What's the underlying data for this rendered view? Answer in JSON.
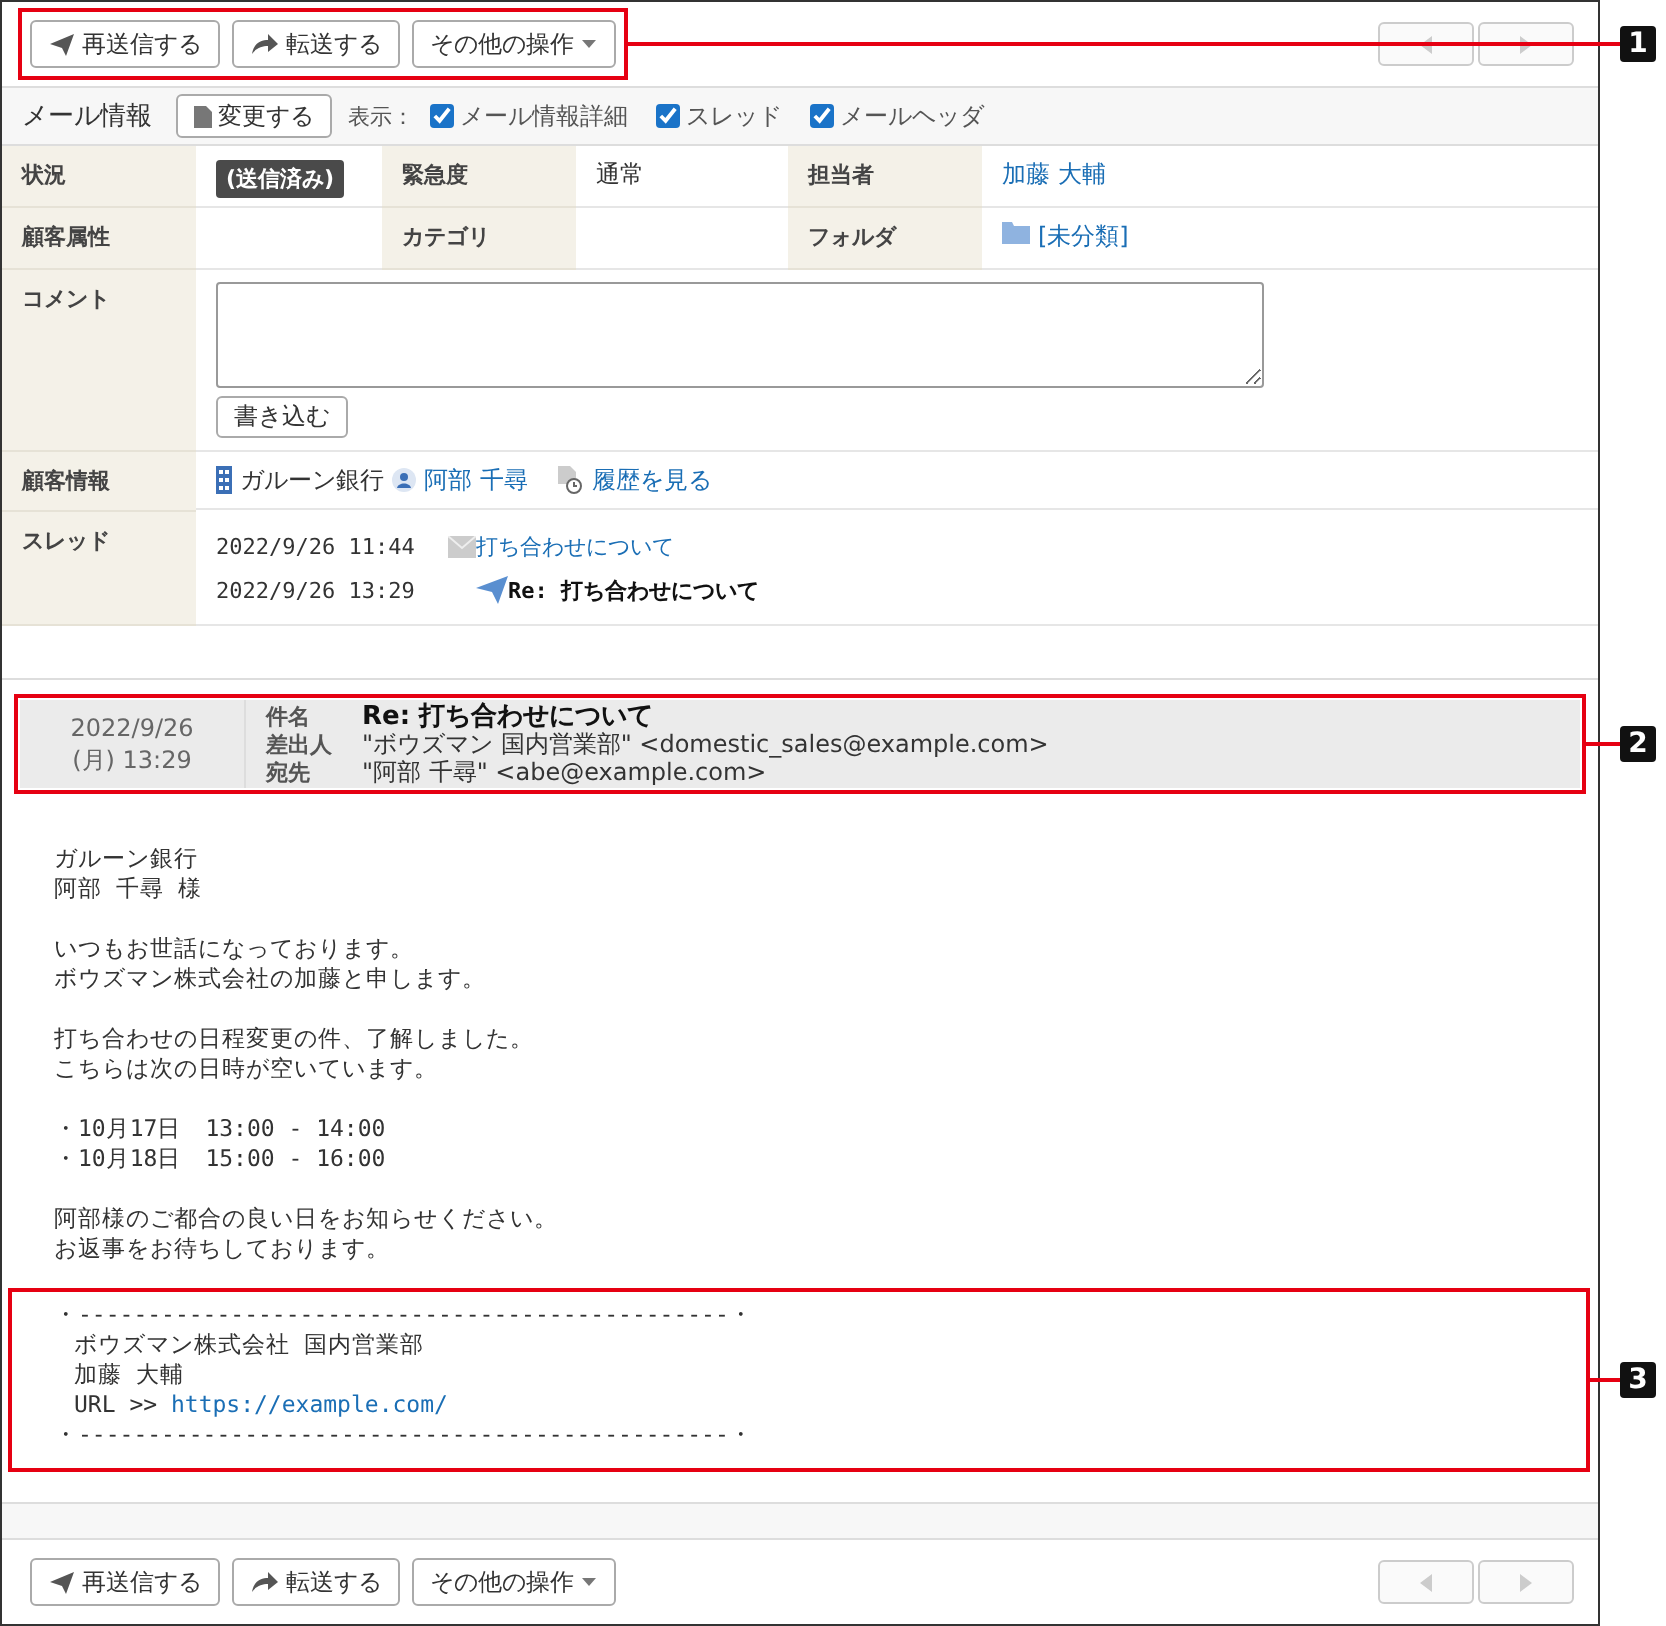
{
  "toolbar_top": {
    "callout": "1",
    "buttons": [
      {
        "kind": "resend",
        "label": "再送信する"
      },
      {
        "kind": "forward",
        "label": "転送する"
      },
      {
        "kind": "menu",
        "label": "その他の操作"
      }
    ],
    "pager": [
      {
        "kind": "prev",
        "disabled": true
      },
      {
        "kind": "next",
        "disabled": true
      }
    ]
  },
  "mail_info": {
    "title": "メール情報",
    "edit_button": "変更する",
    "display_label": "表示：",
    "options": [
      {
        "label": "メール情報詳細",
        "checked": true
      },
      {
        "label": "スレッド",
        "checked": true
      },
      {
        "label": "メールヘッダ",
        "checked": true
      }
    ]
  },
  "details": {
    "status_label": "状況",
    "status": "(送信済み)",
    "priority_label": "緊急度",
    "priority": "通常",
    "assignee_label": "担当者",
    "assignee": "加藤 大輔",
    "customer_attr_label": "顧客属性",
    "category_label": "カテゴリ",
    "folder_label": "フォルダ",
    "folder": "[未分類]",
    "comment_label": "コメント",
    "comment_button": "書き込む",
    "customer_label": "顧客情報",
    "company": "ガルーン銀行",
    "contact": "阿部 千尋",
    "history": "履歴を見る",
    "thread_label": "スレッド",
    "thread": [
      {
        "kind": "received",
        "datetime": "2022/9/26 11:44",
        "subject": "打ち合わせについて",
        "selected": false
      },
      {
        "kind": "sent",
        "datetime": "2022/9/26 13:29",
        "subject": "Re: 打ち合わせについて",
        "selected": true
      }
    ]
  },
  "header": {
    "callout": "2",
    "date": "2022/9/26",
    "time": "(月) 13:29",
    "fields": [
      {
        "kind": "subject",
        "label": "件名",
        "value": "Re: 打ち合わせについて"
      },
      {
        "kind": "address",
        "label": "差出人",
        "value": "\"ボウズマン 国内営業部\" <domestic_sales@example.com>"
      },
      {
        "kind": "address",
        "label": "宛先",
        "value": "\"阿部 千尋\" <abe@example.com>"
      }
    ]
  },
  "body": {
    "paragraphs": [
      [
        "ガルーン銀行",
        "阿部 千尋 様"
      ],
      [
        "いつもお世話になっております。",
        "ボウズマン株式会社の加藤と申します。"
      ],
      [
        "打ち合わせの日程変更の件、了解しました。",
        "こちらは次の日時が空いています。"
      ],
      [
        "・10月17日　13:00 - 14:00",
        "・10月18日　15:00 - 16:00"
      ],
      [
        "阿部様のご都合の良い日をお知らせください。",
        "お返事をお待ちしております。"
      ]
    ],
    "signature": {
      "callout": "3",
      "rule_top": "・-----------------------------------------------・",
      "lines": [
        "ボウズマン株式会社 国内営業部",
        "加藤 大輔"
      ],
      "url_label": "URL >>",
      "url": "https://example.com/",
      "rule_bottom": "・-----------------------------------------------・"
    }
  },
  "toolbar_bottom": {
    "buttons": [
      {
        "kind": "resend",
        "label": "再送信する"
      },
      {
        "kind": "forward",
        "label": "転送する"
      },
      {
        "kind": "menu",
        "label": "その他の操作"
      }
    ],
    "pager": [
      {
        "kind": "prev",
        "disabled": true
      },
      {
        "kind": "next",
        "disabled": true
      }
    ]
  }
}
